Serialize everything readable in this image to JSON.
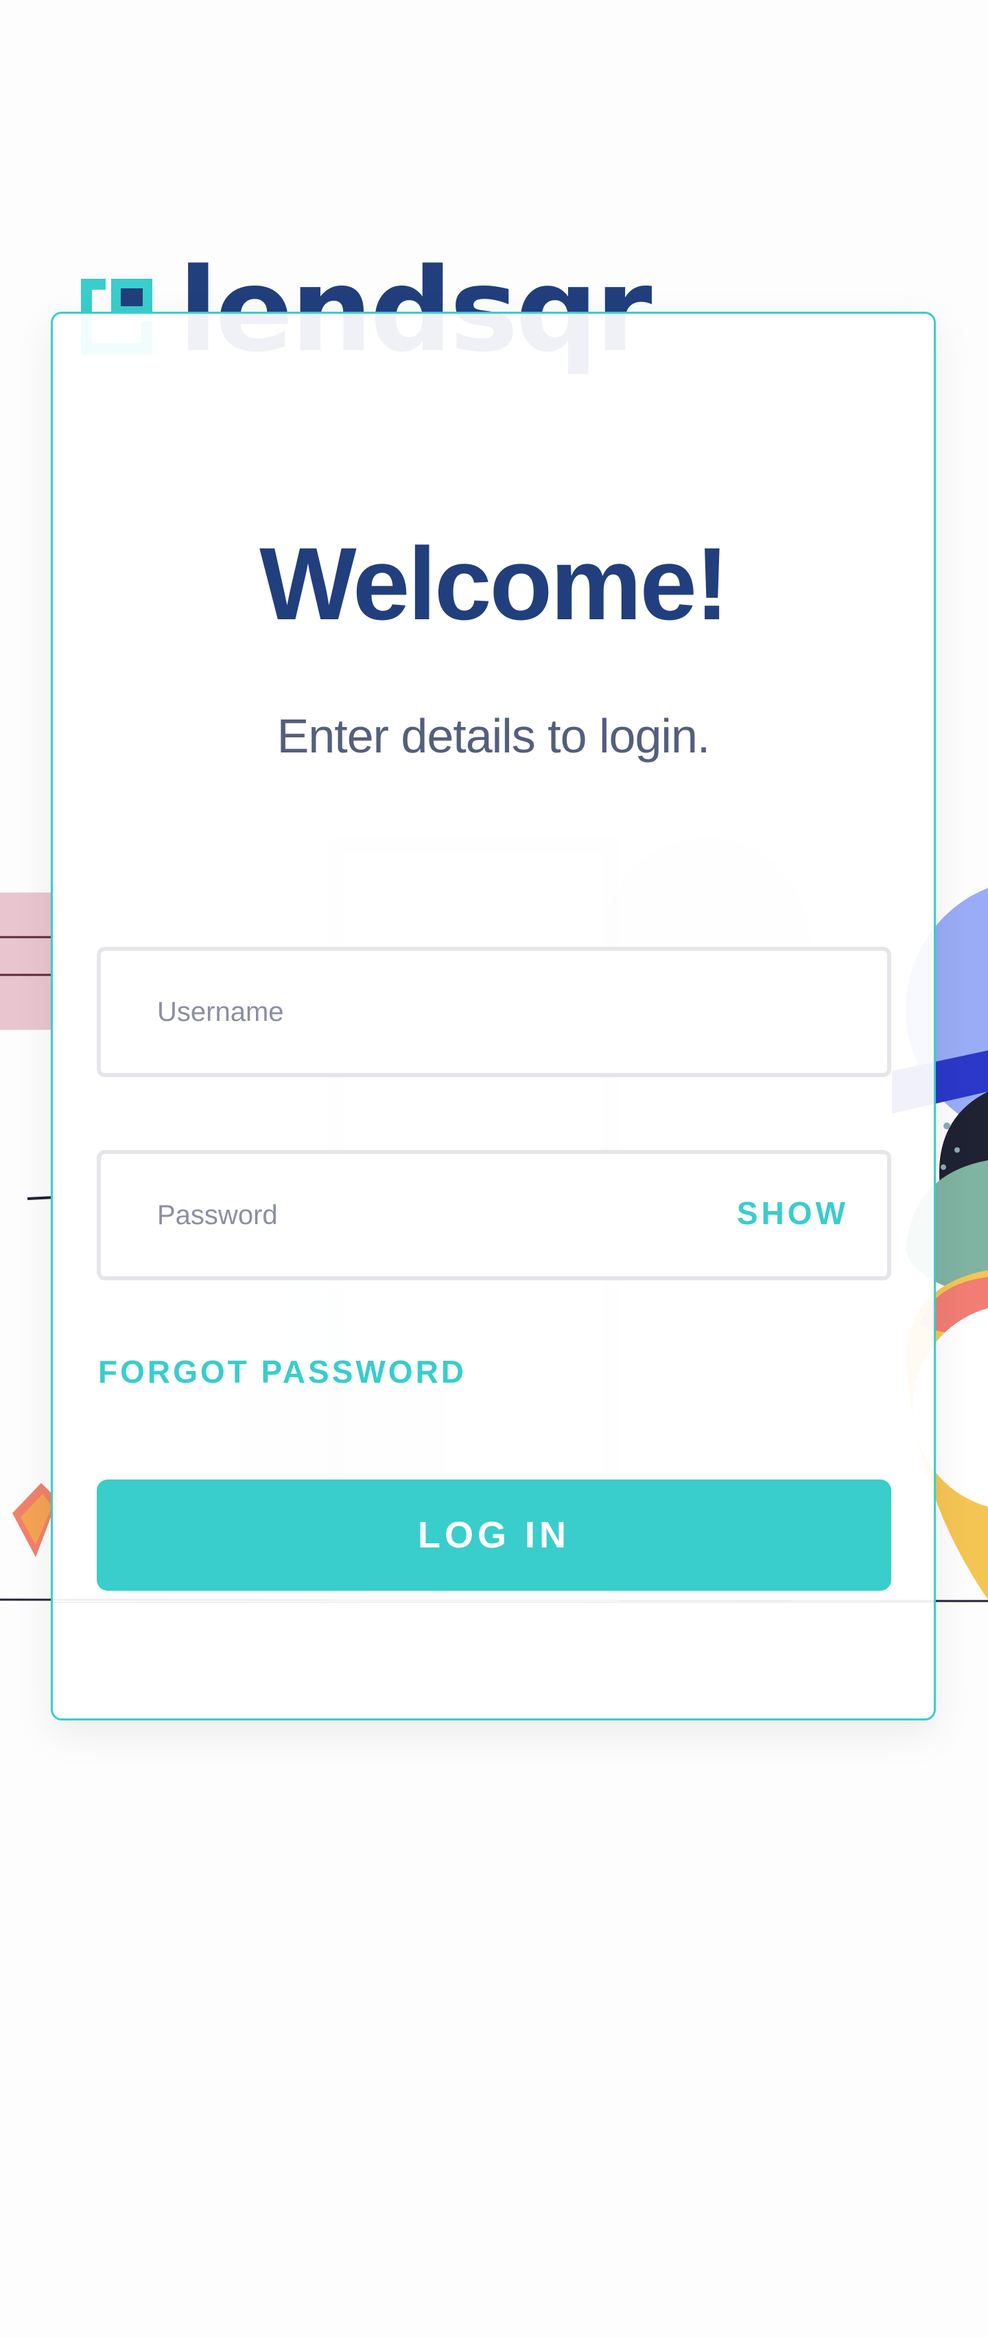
{
  "brand": {
    "name": "lendsqr",
    "primary_color": "#213f7d",
    "accent_color": "#39cdcc"
  },
  "login": {
    "title": "Welcome!",
    "subtitle": "Enter details to login.",
    "username_placeholder": "Username",
    "password_placeholder": "Password",
    "show_label": "SHOW",
    "forgot_label": "FORGOT PASSWORD",
    "submit_label": "LOG IN"
  }
}
